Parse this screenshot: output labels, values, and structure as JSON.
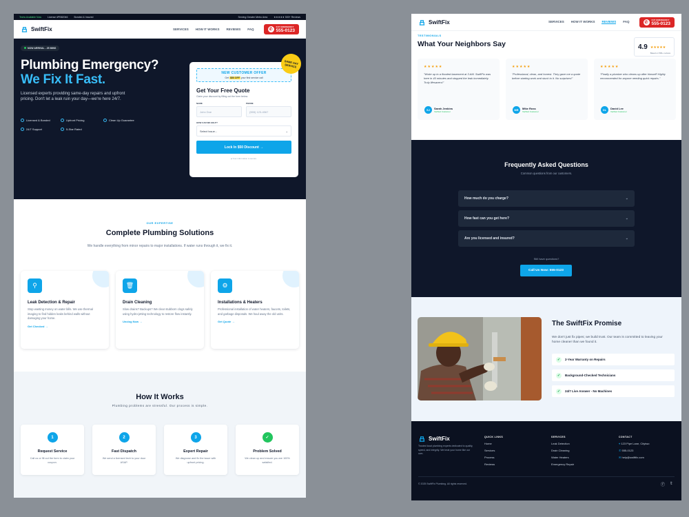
{
  "topbar": {
    "left1": "Techs Available Now",
    "left2": "License #PB82046",
    "left3": "Bonded & Insured",
    "right": "Serving Greater Metro Area",
    "rating": "★★★★★ 500+ Reviews"
  },
  "brand": "SwiftFix",
  "nav": {
    "services": "SERVICES",
    "how": "HOW IT WORKS",
    "reviews": "REVIEWS",
    "faq": "FAQ",
    "call_small": "24/7 EMERGENCY",
    "phone": "555-0123",
    "phone_icon": "phone-icon"
  },
  "hero": {
    "pill": "NOW ARRIVAL - 25 MINS",
    "line1": "Plumbing Emergency?",
    "line2": "We Fix It Fast.",
    "para": "Licensed experts providing same-day repairs and upfront pricing. Don't let a leak ruin your day—we're here 24/7.",
    "bullets": [
      "Licensed & Bonded",
      "Upfront Pricing",
      "Clean Up Guarantee",
      "24/7 Support",
      "5-Star Rated"
    ]
  },
  "quote": {
    "offer_title": "NEW CUSTOMER OFFER",
    "offer_pre": "Get",
    "offer_amt": "$50 OFF",
    "offer_post": "your first service call",
    "badge": "SAME DAY SERVICE",
    "title": "Get Your Free Quote",
    "sub": "Claim your discount by filling out the form below.",
    "name_label": "NAME",
    "name_ph": "John Doe",
    "phone_label": "PHONE",
    "phone_ph": "(555) 123-4567",
    "help_label": "HOW CAN WE HELP?",
    "select": "Select Issue...",
    "button": "Lock In $50 Discount →",
    "note": "Your information is secure."
  },
  "services": {
    "kicker": "OUR EXPERTISE",
    "title": "Complete Plumbing Solutions",
    "sub": "We handle everything from minor repairs to major installations. If water runs through it, we fix it.",
    "cards": [
      {
        "icon": "faucet-icon",
        "title": "Leak Detection & Repair",
        "desc": "Stop wasting money on water bills. We use thermal imaging to find hidden leaks behind walls without damaging your home.",
        "link": "Get Checked →"
      },
      {
        "icon": "trash-icon",
        "title": "Drain Cleaning",
        "desc": "Slow drains? Backups? We clear stubborn clogs safely using hydro-jetting technology to restore flow instantly.",
        "link": "Unclog Now →"
      },
      {
        "icon": "gear-icon",
        "title": "Installations & Heaters",
        "desc": "Professional installation of water heaters, faucets, toilets, and garbage disposals. We haul away the old units.",
        "link": "Get Quote →"
      }
    ]
  },
  "how": {
    "title": "How It Works",
    "sub": "Plumbing problems are stressful. Our process is simple.",
    "steps": [
      {
        "n": "1",
        "title": "Request Service",
        "desc": "Call us or fill out the form to claim your coupon."
      },
      {
        "n": "2",
        "title": "Fast Dispatch",
        "desc": "We send a licensed tech to your door ASAP."
      },
      {
        "n": "3",
        "title": "Expert Repair",
        "desc": "We diagnose and fix the issue with upfront pricing."
      },
      {
        "n": "✓",
        "title": "Problem Solved",
        "desc": "We clean up and ensure you are 100% satisfied."
      }
    ]
  },
  "testimonials": {
    "kicker": "TESTIMONIALS",
    "title": "What Your Neighbors Say",
    "score": "4.9",
    "stars": "★★★★★",
    "score_note": "Based on 500+ reviews",
    "reviews": [
      {
        "stars": "★★★★★",
        "text": "\"Woke up to a flooded basement at 3 AM. SwiftFix was here in 40 minutes and stopped the leak immediately. Truly lifesavers!\"",
        "initials": "SJ",
        "name": "Sarah Jenkins",
        "tag": "Verified Customer"
      },
      {
        "stars": "★★★★★",
        "text": "\"Professional, clean, and honest. They gave me a quote before starting work and stuck to it. No surprises!\"",
        "initials": "MR",
        "name": "Mike Ross",
        "tag": "Verified Customer"
      },
      {
        "stars": "★★★★★",
        "text": "\"Finally a plumber who cleans up after himself! Highly recommended for anyone needing quick repairs.\"",
        "initials": "DL",
        "name": "David Lee",
        "tag": "Verified Customer"
      }
    ]
  },
  "faq": {
    "title": "Frequently Asked Questions",
    "sub": "Common questions from our customers.",
    "items": [
      "How much do you charge?",
      "How fast can you get here?",
      "Are you licensed and insured?"
    ],
    "still": "Still have questions?",
    "cta": "Call Us Now: 555-0123"
  },
  "promise": {
    "title": "The SwiftFix Promise",
    "para": "We don't just fix pipes; we build trust. Our team is committed to leaving your home cleaner than we found it.",
    "checks": [
      "2-Year Warranty on Repairs",
      "Background-Checked Technicians",
      "24/7 Live Answer - No Machines"
    ]
  },
  "footer": {
    "about": "Trusted local plumbing experts dedicated to quality, speed, and integrity. We treat your home like our own.",
    "quick_title": "QUICK LINKS",
    "quick": [
      "Home",
      "Services",
      "Process",
      "Reviews"
    ],
    "services_title": "SERVICES",
    "services": [
      "Leak Detection",
      "Drain Cleaning",
      "Water Heaters",
      "Emergency Repair"
    ],
    "contact_title": "CONTACT",
    "contact": [
      "123 Pipe Lane, Citytwo",
      "555-0123",
      "help@swiftfix.com"
    ],
    "copy": "© 2025 SwiftFix Plumbing. All rights reserved."
  },
  "colors": {
    "navy": "#0f172a",
    "accent": "#0ea5e9",
    "emergency": "#dc2626",
    "star": "#f59e0b",
    "success": "#22c55e"
  }
}
